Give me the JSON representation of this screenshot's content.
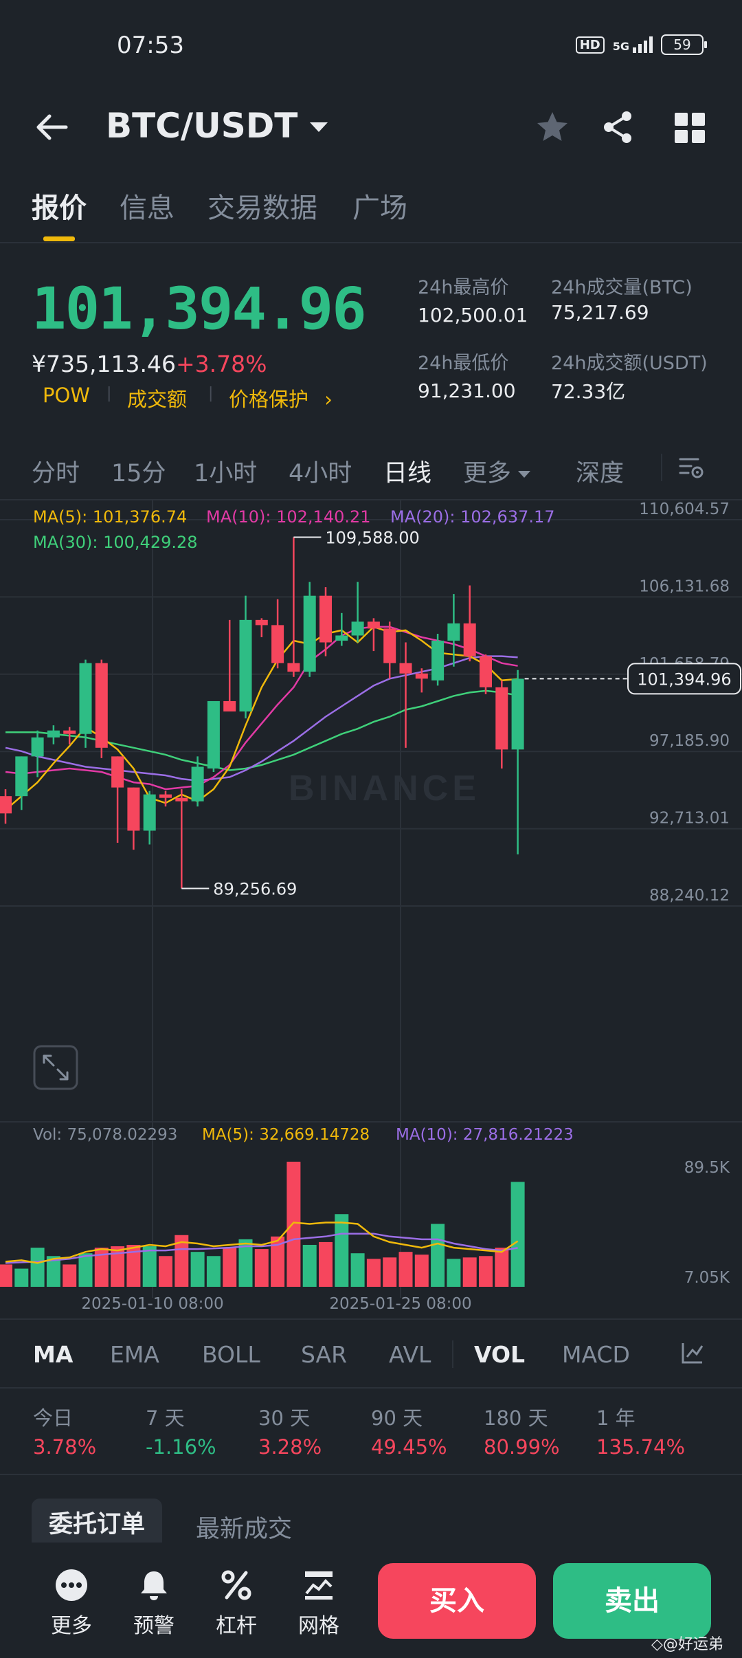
{
  "status_bar": {
    "time": "07:53",
    "hd": "HD",
    "network": "5G",
    "battery": "59"
  },
  "header": {
    "pair": "BTC/USDT"
  },
  "tabs": [
    {
      "label": "报价",
      "active": true
    },
    {
      "label": "信息",
      "active": false
    },
    {
      "label": "交易数据",
      "active": false
    },
    {
      "label": "广场",
      "active": false
    }
  ],
  "price": {
    "last": "101,394.96",
    "cny": "¥735,113.46",
    "change_pct": "+3.78%",
    "tags": [
      "POW",
      "成交额",
      "价格保护"
    ]
  },
  "stats": {
    "high_label": "24h最高价",
    "high_value": "102,500.01",
    "low_label": "24h最低价",
    "low_value": "91,231.00",
    "vol_btc_label": "24h成交量(BTC)",
    "vol_btc_value": "75,217.69",
    "vol_usdt_label": "24h成交额(USDT)",
    "vol_usdt_value": "72.33亿"
  },
  "intervals": [
    "分时",
    "15分",
    "1小时",
    "4小时",
    "日线",
    "更多",
    "深度"
  ],
  "active_interval": "日线",
  "ma_legend": {
    "ma5": "MA(5): 101,376.74",
    "ma10": "MA(10): 102,140.21",
    "ma20": "MA(20): 102,637.17",
    "ma30": "MA(30): 100,429.28"
  },
  "colors": {
    "up": "#2ebd85",
    "down": "#f6465d",
    "accent": "#f0b90b",
    "ma5": "#f0b90b",
    "ma10": "#e23aa5",
    "ma20": "#9b6ee6",
    "ma30": "#3fd07a",
    "vol_ma5": "#f0b90b",
    "vol_ma10": "#9b6ee6"
  },
  "chart_data": {
    "type": "candlestick",
    "y_axis_labels": [
      "110,604.57",
      "106,131.68",
      "101,658.79",
      "97,185.90",
      "92,713.01",
      "88,240.12"
    ],
    "ylim": [
      88240.12,
      110604.57
    ],
    "current_price_label": "101,394.96",
    "current_price": 101394.96,
    "high_marker": "109,588.00",
    "high_value": 109588.0,
    "low_marker": "89,256.69",
    "low_value": 89256.69,
    "watermark": "BINANCE",
    "candles": [
      {
        "o": 94600,
        "h": 95000,
        "c": 93600,
        "l": 93000
      },
      {
        "o": 94600,
        "h": 96900,
        "c": 96900,
        "l": 93800
      },
      {
        "o": 96900,
        "h": 98400,
        "c": 98000,
        "l": 95700
      },
      {
        "o": 98000,
        "h": 98700,
        "c": 98400,
        "l": 97600
      },
      {
        "o": 98400,
        "h": 98600,
        "c": 98200,
        "l": 97600
      },
      {
        "o": 98200,
        "h": 102500,
        "c": 102300,
        "l": 97400
      },
      {
        "o": 102300,
        "h": 102500,
        "c": 97400,
        "l": 96800
      },
      {
        "o": 96900,
        "h": 96900,
        "c": 95100,
        "l": 91900
      },
      {
        "o": 95100,
        "h": 95100,
        "c": 92600,
        "l": 91500
      },
      {
        "o": 92600,
        "h": 94900,
        "c": 94700,
        "l": 91800
      },
      {
        "o": 94700,
        "h": 94900,
        "c": 94500,
        "l": 94000
      },
      {
        "o": 94500,
        "h": 95000,
        "c": 94300,
        "l": 89256.69
      },
      {
        "o": 94300,
        "h": 96900,
        "c": 96300,
        "l": 94000
      },
      {
        "o": 96200,
        "h": 100100,
        "c": 100100,
        "l": 96000
      },
      {
        "o": 100100,
        "h": 104800,
        "c": 99500,
        "l": 99500
      },
      {
        "o": 99500,
        "h": 106200,
        "c": 104800,
        "l": 99100
      },
      {
        "o": 104800,
        "h": 104900,
        "c": 104500,
        "l": 103800
      },
      {
        "o": 104500,
        "h": 106000,
        "c": 102300,
        "l": 102000
      },
      {
        "o": 102300,
        "h": 109588,
        "c": 101800,
        "l": 101500
      },
      {
        "o": 101800,
        "h": 107000,
        "c": 106200,
        "l": 101500
      },
      {
        "o": 106200,
        "h": 106700,
        "c": 103500,
        "l": 102700
      },
      {
        "o": 103600,
        "h": 105200,
        "c": 103900,
        "l": 103300
      },
      {
        "o": 103900,
        "h": 107000,
        "c": 104700,
        "l": 103500
      },
      {
        "o": 104700,
        "h": 104900,
        "c": 104300,
        "l": 103000
      },
      {
        "o": 104300,
        "h": 104700,
        "c": 102300,
        "l": 101400
      },
      {
        "o": 102300,
        "h": 103500,
        "c": 101700,
        "l": 97400
      },
      {
        "o": 101700,
        "h": 102000,
        "c": 101400,
        "l": 100600
      },
      {
        "o": 101300,
        "h": 104000,
        "c": 103600,
        "l": 101000
      },
      {
        "o": 103600,
        "h": 106300,
        "c": 104600,
        "l": 102100
      },
      {
        "o": 104600,
        "h": 106800,
        "c": 102700,
        "l": 102400
      },
      {
        "o": 102700,
        "h": 102800,
        "c": 100900,
        "l": 100500
      },
      {
        "o": 100900,
        "h": 101300,
        "c": 97300,
        "l": 96200
      },
      {
        "o": 97300,
        "h": 101900,
        "c": 101394.96,
        "l": 91231
      }
    ],
    "ma5": [
      93800,
      94600,
      95400,
      96500,
      97500,
      98600,
      98000,
      97300,
      96200,
      94500,
      94200,
      94700,
      94300,
      95000,
      96300,
      98700,
      100900,
      102500,
      103600,
      103400,
      104000,
      104200,
      103500,
      104400,
      104100,
      104200,
      103600,
      102900,
      102800,
      102700,
      102200,
      101300,
      101376.74
    ],
    "ma10": [
      96000,
      95900,
      96000,
      96100,
      96200,
      96100,
      96000,
      95700,
      95400,
      95300,
      95000,
      95100,
      95200,
      95700,
      96400,
      97700,
      98800,
      99900,
      100900,
      102400,
      103100,
      103900,
      104300,
      104400,
      104400,
      104100,
      103800,
      103600,
      103400,
      103100,
      102700,
      102300,
      102140.21
    ],
    "ma20": [
      97400,
      97200,
      96900,
      96700,
      96500,
      96300,
      96200,
      96100,
      96000,
      95900,
      95800,
      95600,
      95500,
      95600,
      95700,
      96100,
      96600,
      97200,
      97800,
      98500,
      99200,
      99800,
      100400,
      101000,
      101400,
      101600,
      101800,
      102000,
      102300,
      102600,
      102700,
      102700,
      102637.17
    ],
    "ma30": [
      98300,
      98300,
      98300,
      98200,
      98100,
      98000,
      97800,
      97600,
      97400,
      97200,
      97000,
      96700,
      96500,
      96300,
      96100,
      96200,
      96400,
      96700,
      97000,
      97400,
      97800,
      98200,
      98500,
      98900,
      99200,
      99600,
      99800,
      100100,
      100400,
      100600,
      100700,
      100600,
      100429.28
    ],
    "volume_legend": {
      "vol": "Vol: 75,078.02293",
      "ma5": "MA(5): 32,669.14728",
      "ma10": "MA(10): 27,816.21223"
    },
    "volume_axis_labels": [
      "89.5K",
      "7.05K"
    ],
    "volume_ylim": [
      0,
      89500
    ],
    "volumes": [
      16000,
      13000,
      28000,
      22000,
      16000,
      24000,
      28000,
      29000,
      30000,
      29000,
      22000,
      37000,
      25000,
      22000,
      28000,
      34000,
      27000,
      36000,
      89500,
      30000,
      32000,
      52000,
      24000,
      20000,
      21000,
      25000,
      23000,
      45000,
      20000,
      21000,
      22000,
      28000,
      75078
    ],
    "vol_ma5": [
      18000,
      19000,
      17000,
      20000,
      21000,
      25000,
      27000,
      26000,
      28000,
      30000,
      29000,
      32000,
      31000,
      29000,
      30000,
      31000,
      30000,
      33000,
      46000,
      45000,
      46000,
      46000,
      45000,
      36000,
      32000,
      30000,
      28000,
      31000,
      28000,
      27000,
      26000,
      25000,
      32669
    ],
    "vol_ma10": [
      17000,
      17500,
      18000,
      19000,
      20000,
      22000,
      23000,
      24000,
      25000,
      26000,
      26000,
      27000,
      27000,
      27500,
      28000,
      29000,
      29000,
      30000,
      34000,
      35000,
      36000,
      38000,
      38000,
      38000,
      36000,
      35000,
      34000,
      34000,
      31000,
      29000,
      27000,
      26000,
      27816
    ],
    "x_labels": [
      "2025-01-10 08:00",
      "2025-01-25 08:00"
    ]
  },
  "indicators": {
    "main": [
      "MA",
      "EMA",
      "BOLL",
      "SAR",
      "AVL"
    ],
    "sub": [
      "VOL",
      "MACD"
    ],
    "active_main": "MA",
    "active_sub": "VOL"
  },
  "performance": [
    {
      "label": "今日",
      "value": "3.78%",
      "dir": "up"
    },
    {
      "label": "7 天",
      "value": "-1.16%",
      "dir": "down"
    },
    {
      "label": "30 天",
      "value": "3.28%",
      "dir": "up"
    },
    {
      "label": "90 天",
      "value": "49.45%",
      "dir": "up"
    },
    {
      "label": "180 天",
      "value": "80.99%",
      "dir": "up"
    },
    {
      "label": "1 年",
      "value": "135.74%",
      "dir": "up"
    }
  ],
  "orders": {
    "tab_open": "委托订单",
    "tab_trades": "最新成交"
  },
  "bottom_bar": {
    "more": "更多",
    "alert": "预警",
    "leverage": "杠杆",
    "grid": "网格",
    "buy": "买入",
    "sell": "卖出",
    "watermark": "◇@好运弟"
  }
}
